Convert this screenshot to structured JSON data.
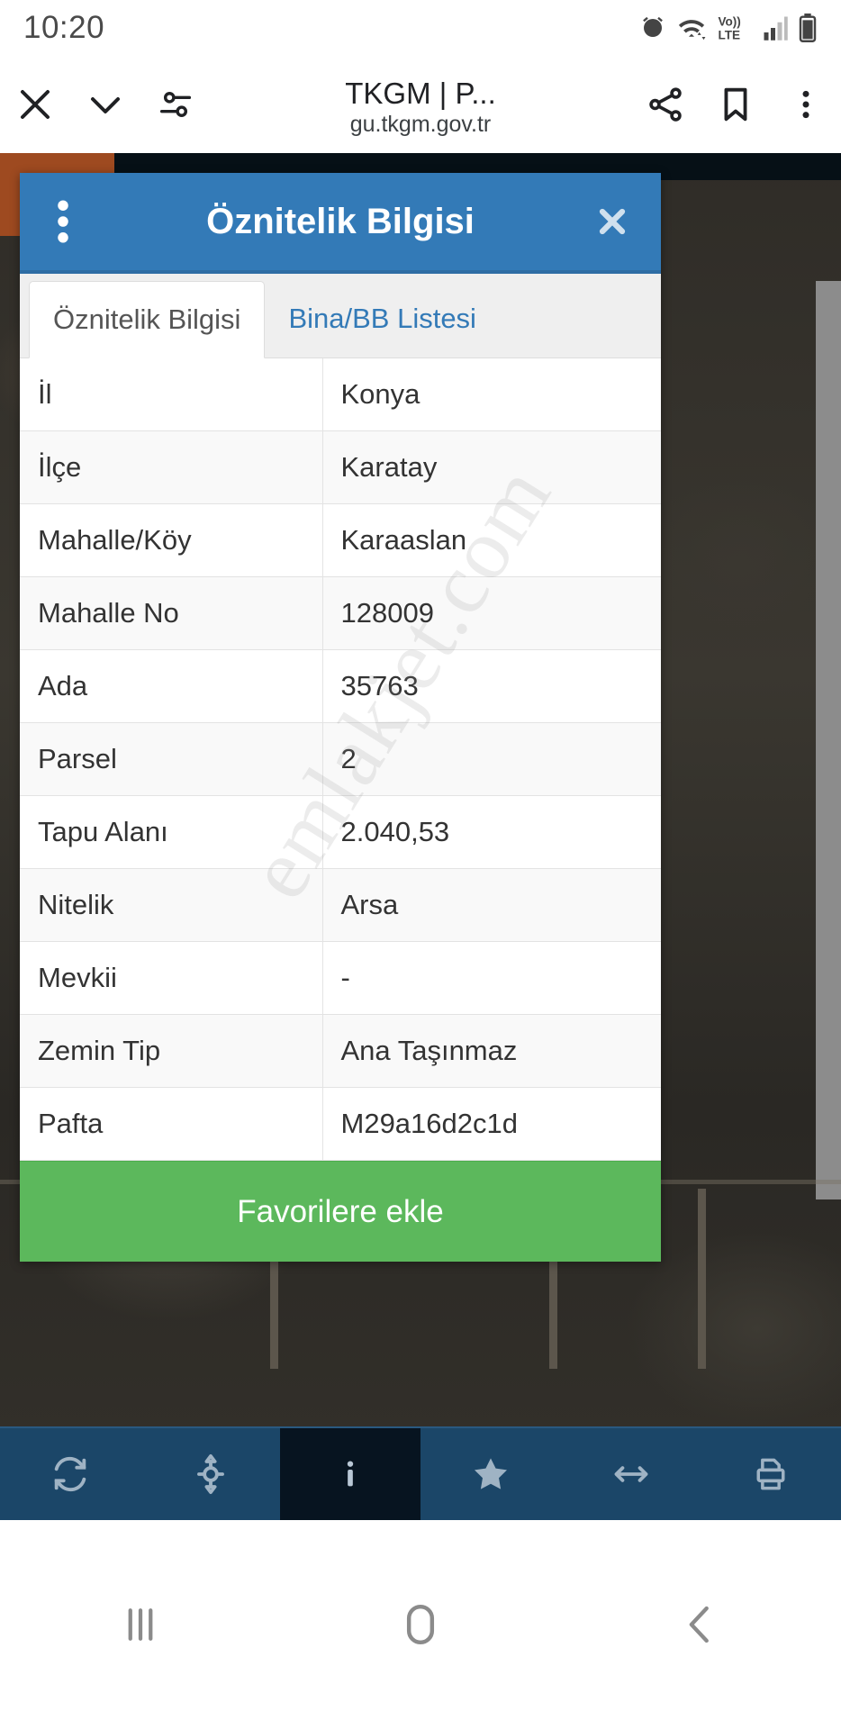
{
  "status_bar": {
    "time": "10:20",
    "icons": [
      "alarm-icon",
      "wifi-icon",
      "volte-icon",
      "signal-icon",
      "battery-icon"
    ]
  },
  "browser_bar": {
    "close_label": "close-icon",
    "collapse_label": "chevron-down-icon",
    "page_info_label": "page-settings-icon",
    "title": "TKGM | P...",
    "url": "gu.tkgm.gov.tr",
    "share_label": "share-icon",
    "bookmark_label": "bookmark-icon",
    "menu_label": "overflow-menu-icon"
  },
  "dialog": {
    "title": "Öznitelik Bilgisi",
    "header_color": "#337ab7",
    "kebab_label": "dialog-menu-icon",
    "close_label": "dialog-close-icon",
    "tabs": [
      {
        "label": "Öznitelik Bilgisi",
        "active": true
      },
      {
        "label": "Bina/BB Listesi",
        "active": false
      }
    ],
    "rows": [
      {
        "key": "İl",
        "value": "Konya"
      },
      {
        "key": "İlçe",
        "value": "Karatay"
      },
      {
        "key": "Mahalle/Köy",
        "value": "Karaaslan"
      },
      {
        "key": "Mahalle No",
        "value": "128009"
      },
      {
        "key": "Ada",
        "value": "35763"
      },
      {
        "key": "Parsel",
        "value": "2"
      },
      {
        "key": "Tapu Alanı",
        "value": "2.040,53"
      },
      {
        "key": "Nitelik",
        "value": "Arsa"
      },
      {
        "key": "Mevkii",
        "value": "-"
      },
      {
        "key": "Zemin Tip",
        "value": "Ana Taşınmaz"
      },
      {
        "key": "Pafta",
        "value": "M29a16d2c1d"
      }
    ],
    "favorite_button": {
      "label": "Favorilere ekle",
      "color": "#5cb85c"
    }
  },
  "watermark": {
    "text": "emlakjet.com"
  },
  "app_toolbar": {
    "background": "#1b4668",
    "active_background": "#071420",
    "items": [
      {
        "name": "refresh-icon",
        "active": false
      },
      {
        "name": "locate-icon",
        "active": false
      },
      {
        "name": "info-icon",
        "active": true
      },
      {
        "name": "star-icon",
        "active": false
      },
      {
        "name": "measure-icon",
        "active": false
      },
      {
        "name": "print-icon",
        "active": false
      }
    ]
  },
  "nav_bar": {
    "recents_label": "recents-icon",
    "home_label": "home-icon",
    "back_label": "back-icon"
  }
}
